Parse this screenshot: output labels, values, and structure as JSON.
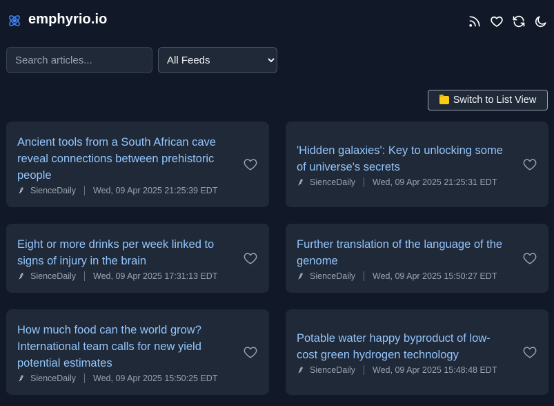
{
  "app": {
    "brand": "emphyrio.io"
  },
  "header_icons": [
    "rss-icon",
    "heart-icon",
    "refresh-icon",
    "moon-icon"
  ],
  "search": {
    "placeholder": "Search articles...",
    "value": ""
  },
  "feed_select": {
    "selected": "All Feeds"
  },
  "view_toggle": {
    "label": "Switch to List View",
    "icon": "folder-icon"
  },
  "colors": {
    "background": "#111827",
    "card": "#1f2937",
    "link": "#93c5fd",
    "meta": "#9ca3af"
  },
  "articles": [
    {
      "title": "Ancient tools from a South African cave reveal connections between prehistoric people",
      "source": "SienceDaily",
      "date": "Wed, 09 Apr 2025 21:25:39 EDT"
    },
    {
      "title": "'Hidden galaxies': Key to unlocking some of universe's secrets",
      "source": "SienceDaily",
      "date": "Wed, 09 Apr 2025 21:25:31 EDT"
    },
    {
      "title": "Eight or more drinks per week linked to signs of injury in the brain",
      "source": "SienceDaily",
      "date": "Wed, 09 Apr 2025 17:31:13 EDT"
    },
    {
      "title": "Further translation of the language of the genome",
      "source": "SienceDaily",
      "date": "Wed, 09 Apr 2025 15:50:27 EDT"
    },
    {
      "title": "How much food can the world grow? International team calls for new yield potential estimates",
      "source": "SienceDaily",
      "date": "Wed, 09 Apr 2025 15:50:25 EDT"
    },
    {
      "title": "Potable water happy byproduct of low-cost green hydrogen technology",
      "source": "SienceDaily",
      "date": "Wed, 09 Apr 2025 15:48:48 EDT"
    }
  ]
}
